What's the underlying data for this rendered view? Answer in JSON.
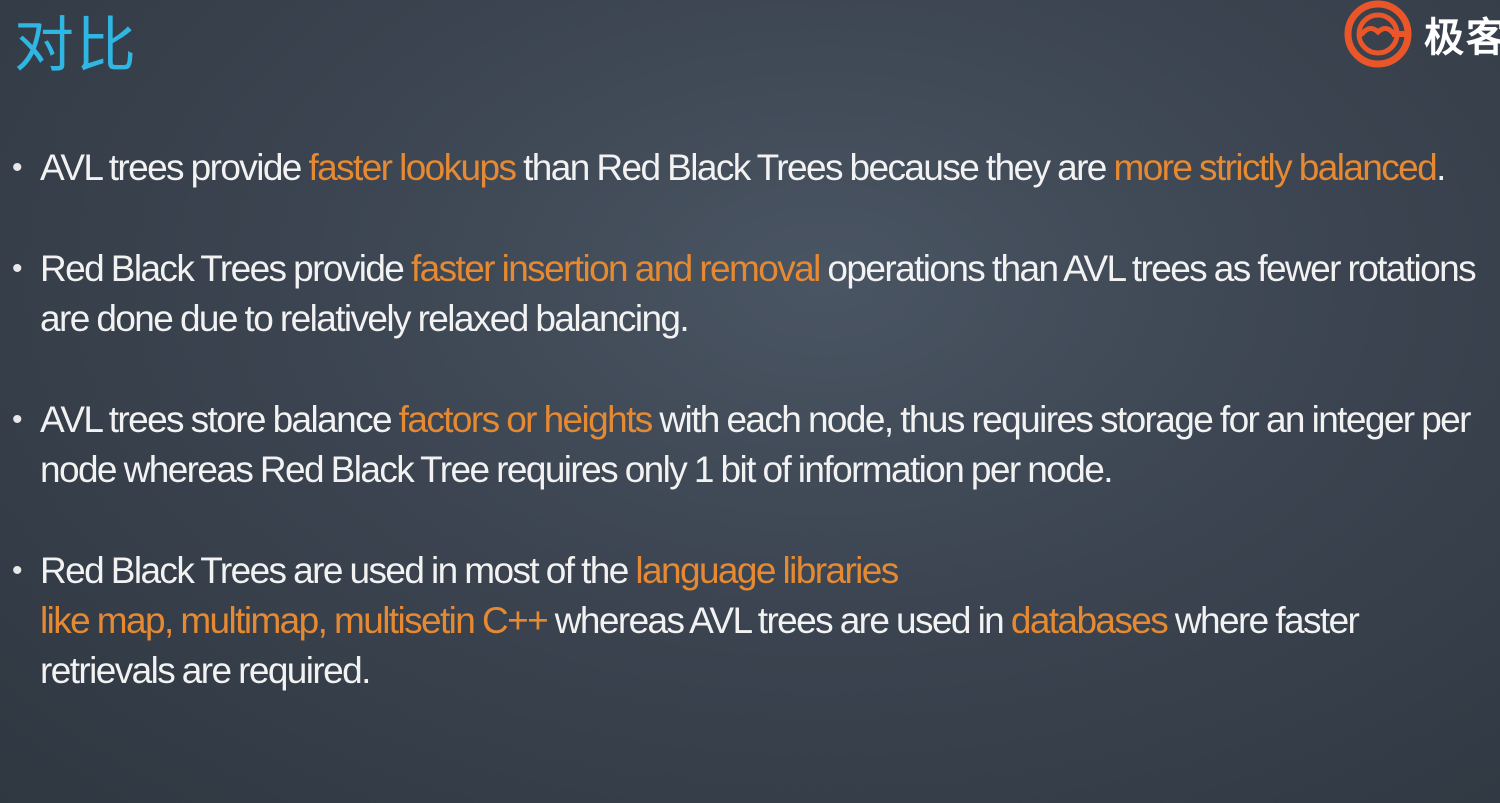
{
  "title": "对比",
  "logo": {
    "text": "极客"
  },
  "colors": {
    "title": "#2fb6e3",
    "highlight": "#e58a32",
    "text": "#f2f2f2",
    "background": "#3b4450",
    "logo_ring": "#e8562a"
  },
  "bullets": [
    {
      "parts": [
        {
          "t": "AVL trees provide ",
          "hl": false
        },
        {
          "t": "faster lookups",
          "hl": true
        },
        {
          "t": " than Red Black Trees because they are ",
          "hl": false
        },
        {
          "t": "more strictly balanced",
          "hl": true
        },
        {
          "t": ".",
          "hl": false
        }
      ]
    },
    {
      "parts": [
        {
          "t": "Red Black Trees provide ",
          "hl": false
        },
        {
          "t": "faster insertion and removal",
          "hl": true
        },
        {
          "t": " operations than AVL trees as fewer rotations are done due to relatively relaxed balancing.",
          "hl": false
        }
      ]
    },
    {
      "parts": [
        {
          "t": "AVL trees store balance ",
          "hl": false
        },
        {
          "t": "factors or heights",
          "hl": true
        },
        {
          "t": " with each node, thus requires storage for an integer per node whereas Red Black Tree requires only 1 bit of information per node.",
          "hl": false
        }
      ]
    },
    {
      "parts": [
        {
          "t": "Red Black Trees are used in most of the ",
          "hl": false
        },
        {
          "t": "language libraries",
          "hl": true
        },
        {
          "br": true
        },
        {
          "t": "like map, multimap, multisetin C++",
          "hl": true
        },
        {
          "t": " whereas AVL trees are used in ",
          "hl": false
        },
        {
          "t": "databases",
          "hl": true
        },
        {
          "t": " where faster retrievals are required.",
          "hl": false
        }
      ]
    }
  ]
}
